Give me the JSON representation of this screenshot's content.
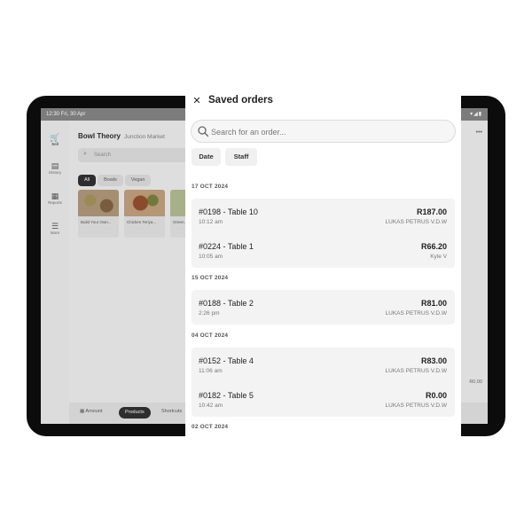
{
  "status_bar": {
    "time": "12:30 Fri, 30 Apr",
    "icons": "▾◢▮"
  },
  "background_app": {
    "rail": [
      {
        "icon": "cart-icon",
        "glyph": "🛒",
        "label": "Sell"
      },
      {
        "icon": "history-icon",
        "glyph": "▤",
        "label": "History"
      },
      {
        "icon": "reports-icon",
        "glyph": "▦",
        "label": "Reports"
      },
      {
        "icon": "more-icon",
        "glyph": "☰",
        "label": "More"
      }
    ],
    "store_name": "Bowl Theory",
    "location": "Junction Market",
    "search_placeholder": "Search",
    "filters": [
      "All",
      "Bowls",
      "Vegan"
    ],
    "tiles": [
      "Build Your Own...",
      "Chicken Teriya...",
      "Green..."
    ],
    "bottom_tabs": [
      "Amount",
      "Products",
      "Shortcuts"
    ],
    "overflow": "•••",
    "total": "R0.00"
  },
  "panel": {
    "title": "Saved orders",
    "close_icon": "close-icon",
    "search": {
      "placeholder": "Search for an order...",
      "value": ""
    },
    "filter_buttons": [
      "Date",
      "Staff"
    ],
    "groups": [
      {
        "date": "17 OCT 2024",
        "orders": [
          {
            "id": "#0198 - Table 10",
            "time": "10:12 am",
            "amount": "R187.00",
            "staff": "LUKAS PETRUS V.D.W"
          },
          {
            "id": "#0224 - Table 1",
            "time": "10:05 am",
            "amount": "R66.20",
            "staff": "Kyle V"
          }
        ]
      },
      {
        "date": "15 OCT 2024",
        "orders": [
          {
            "id": "#0188 - Table 2",
            "time": "2:26 pm",
            "amount": "R81.00",
            "staff": "LUKAS PETRUS V.D.W"
          }
        ]
      },
      {
        "date": "04 OCT 2024",
        "orders": [
          {
            "id": "#0152 - Table 4",
            "time": "11:06 am",
            "amount": "R83.00",
            "staff": "LUKAS PETRUS V.D.W"
          },
          {
            "id": "#0182 - Table 5",
            "time": "10:42 am",
            "amount": "R0.00",
            "staff": "LUKAS PETRUS V.D.W"
          }
        ]
      },
      {
        "date": "02 OCT 2024",
        "orders": []
      }
    ]
  }
}
